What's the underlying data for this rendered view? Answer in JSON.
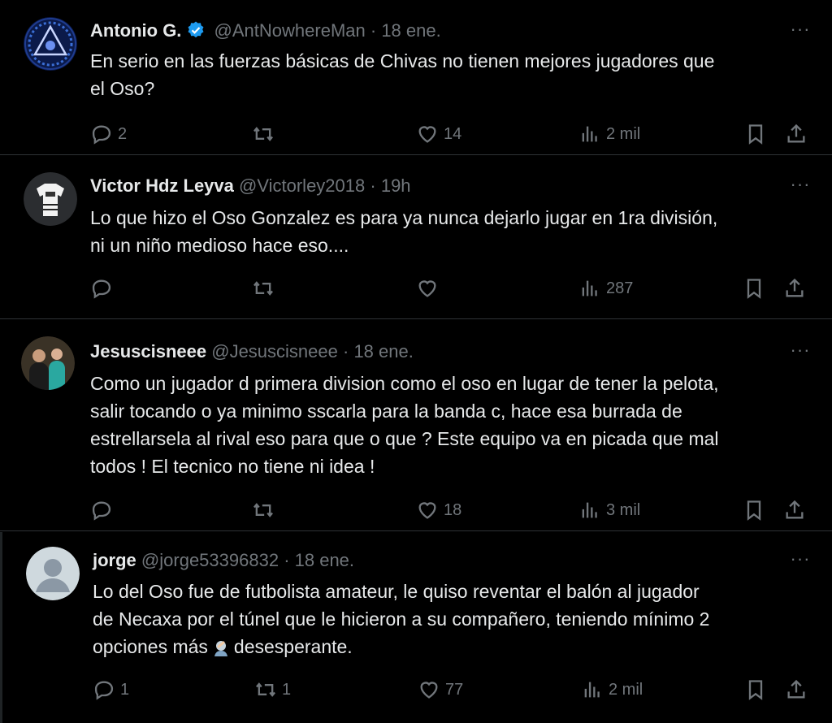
{
  "tweets": [
    {
      "name": "Antonio G.",
      "handle": "@AntNowhereMan",
      "time": "· 18 ene.",
      "verified": true,
      "text_lines": [
        "En serio en las fuerzas básicas de Chivas no tienen mejores jugadores que",
        "el Oso?"
      ],
      "replies": "2",
      "retweets": "",
      "likes": "14",
      "views": "2 mil"
    },
    {
      "name": "Victor Hdz Leyva",
      "handle": "@Victorley2018",
      "time": "· 19h",
      "verified": false,
      "text_lines": [
        "Lo que hizo el Oso Gonzalez es para ya nunca dejarlo jugar en 1ra división,",
        "ni un niño medioso hace eso...."
      ],
      "replies": "",
      "retweets": "",
      "likes": "",
      "views": "287"
    },
    {
      "name": "Jesuscisneee",
      "handle": "@Jesuscisneee",
      "time": "· 18 ene.",
      "verified": false,
      "text_lines": [
        "Como un jugador d primera division como el oso en lugar de tener la pelota,",
        "salir tocando o ya minimo sscarla para la banda c, hace esa burrada de",
        "estrellarsela al rival eso para que o que ?  Este equipo va en picada que mal",
        "todos ! El tecnico no tiene ni idea !"
      ],
      "replies": "",
      "retweets": "",
      "likes": "18",
      "views": "3 mil"
    },
    {
      "name": "jorge",
      "handle": "@jorge53396832",
      "time": "· 18 ene.",
      "verified": false,
      "text_lines": [
        "Lo del Oso fue de futbolista amateur, le quiso reventar el balón al jugador",
        "de Necaxa por el túnel que le hicieron a su compañero, teniendo mínimo 2"
      ],
      "text_last_before": "opciones más",
      "text_last_after": "desesperante.",
      "replies": "1",
      "retweets": "1",
      "likes": "77",
      "views": "2 mil"
    }
  ],
  "icons": {
    "reply": "reply-icon",
    "retweet": "retweet-icon",
    "like": "like-icon",
    "views": "views-icon",
    "bookmark": "bookmark-icon",
    "share": "share-icon",
    "more": "more-icon",
    "verified": "verified-badge-icon",
    "emoji": "facepalm-emoji-icon"
  },
  "colors": {
    "background": "#000000",
    "text": "#e7e9ea",
    "muted": "#71767b",
    "verified": "#1d9bf0",
    "divider": "#2f3336"
  }
}
